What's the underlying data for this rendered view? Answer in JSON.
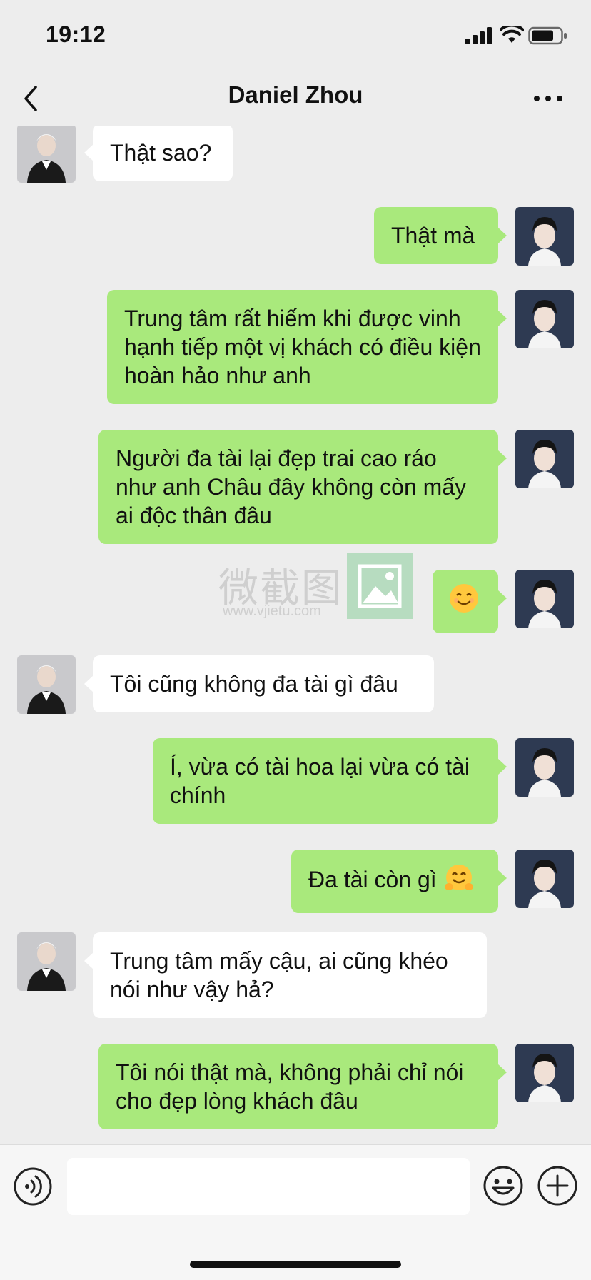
{
  "status": {
    "time": "19:12"
  },
  "header": {
    "title": "Daniel Zhou"
  },
  "messages": [
    {
      "side": "in",
      "text": "Thật sao?"
    },
    {
      "side": "out",
      "text": "Thật mà"
    },
    {
      "side": "out",
      "text": "Trung tâm rất hiếm khi được vinh hạnh tiếp một vị khách có điều kiện hoàn hảo như anh"
    },
    {
      "side": "out",
      "text": "Người đa tài lại đẹp trai cao ráo như anh Châu đây không còn mấy ai độc thân đâu"
    },
    {
      "side": "out",
      "text": "",
      "emoji": "smiling-face-emoji"
    },
    {
      "side": "in",
      "text": "Tôi cũng không đa tài gì đâu"
    },
    {
      "side": "out",
      "text": "Í, vừa có tài hoa lại vừa có tài chính"
    },
    {
      "side": "out",
      "text": "Đa tài còn gì ",
      "emoji": "hugging-face-emoji"
    },
    {
      "side": "in",
      "text": "Trung tâm mấy cậu, ai cũng khéo nói như vậy hả?"
    },
    {
      "side": "out",
      "text": "Tôi nói thật mà, không phải chỉ nói cho đẹp lòng khách đâu"
    }
  ],
  "watermark": {
    "text": "微截图",
    "url": "www.vjietu.com"
  },
  "input": {
    "value": "",
    "placeholder": ""
  },
  "colors": {
    "out_bubble": "#a9e97c",
    "in_bubble": "#ffffff",
    "background": "#ededed"
  },
  "icons": [
    "back-chevron-icon",
    "more-dots-icon",
    "voice-icon",
    "emoji-face-icon",
    "plus-icon",
    "signal-icon",
    "wifi-icon",
    "battery-icon"
  ]
}
